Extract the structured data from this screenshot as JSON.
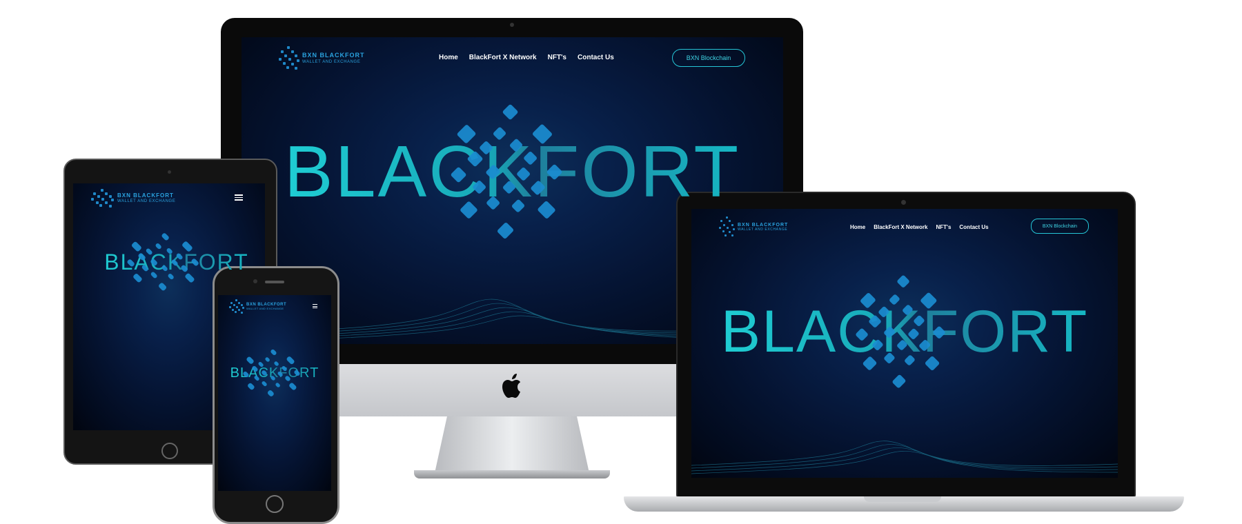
{
  "brand": {
    "logo_title": "BXN BLACKFORT",
    "logo_subtitle": "WALLET AND EXCHANGE"
  },
  "nav": {
    "links": [
      "Home",
      "BlackFort X Network",
      "NFT's",
      "Contact Us"
    ],
    "cta_label": "BXN Blockchain"
  },
  "hero": {
    "word": "BLACKFORT"
  },
  "colors": {
    "accent": "#25c7d8",
    "logo_blue": "#2aa3e0",
    "hero_teal": "#19b7c4",
    "background": "#051433"
  },
  "icons": {
    "menu": "hamburger-icon",
    "apple": "apple-logo-icon"
  }
}
